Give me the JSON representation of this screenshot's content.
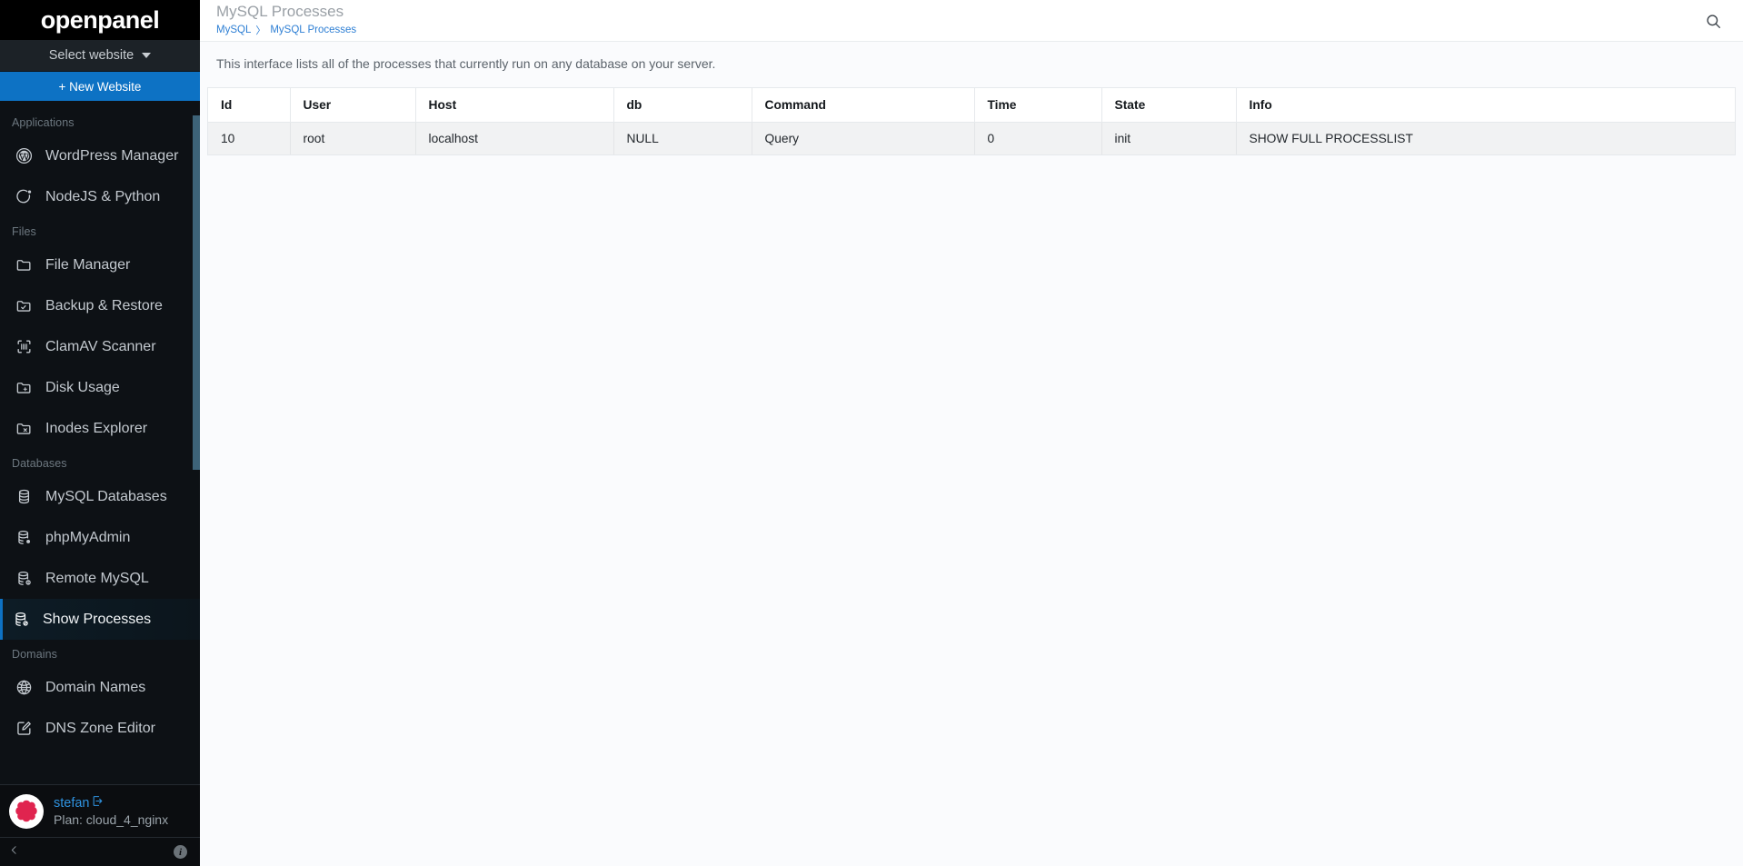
{
  "brand": {
    "name": "openpanel"
  },
  "sidebar": {
    "website_selector": {
      "label": "Select website",
      "icon": "chevron-down-icon"
    },
    "new_website_button": {
      "label": "+ New Website"
    },
    "sections": [
      {
        "label": "Applications",
        "items": [
          {
            "label": "WordPress Manager",
            "icon": "wordpress-icon",
            "active": false
          },
          {
            "label": "NodeJS & Python",
            "icon": "node-python-icon",
            "active": false
          }
        ]
      },
      {
        "label": "Files",
        "items": [
          {
            "label": "File Manager",
            "icon": "folder-icon",
            "active": false
          },
          {
            "label": "Backup & Restore",
            "icon": "folder-check-icon",
            "active": false
          },
          {
            "label": "ClamAV Scanner",
            "icon": "scan-icon",
            "active": false
          },
          {
            "label": "Disk Usage",
            "icon": "folder-plus-icon",
            "active": false
          },
          {
            "label": "Inodes Explorer",
            "icon": "folder-x-icon",
            "active": false
          }
        ]
      },
      {
        "label": "Databases",
        "items": [
          {
            "label": "MySQL Databases",
            "icon": "database-icon",
            "active": false
          },
          {
            "label": "phpMyAdmin",
            "icon": "database-cog-icon",
            "active": false
          },
          {
            "label": "Remote MySQL",
            "icon": "database-info-icon",
            "active": false
          },
          {
            "label": "Show Processes",
            "icon": "database-ban-icon",
            "active": true
          }
        ]
      },
      {
        "label": "Domains",
        "items": [
          {
            "label": "Domain Names",
            "icon": "globe-icon",
            "active": false
          },
          {
            "label": "DNS Zone Editor",
            "icon": "edit-square-icon",
            "active": false
          }
        ]
      }
    ],
    "user": {
      "name": "stefan",
      "logout_icon": "logout-icon",
      "plan": "Plan: cloud_4_nginx",
      "avatar_icon": "avatar-badge-icon"
    },
    "bottom": {
      "collapse_icon": "chevron-left-icon",
      "info_icon": "info-icon",
      "info_label": "i"
    }
  },
  "header": {
    "title": "MySQL Processes",
    "breadcrumb": [
      {
        "label": "MySQL"
      },
      {
        "label": "MySQL Processes"
      }
    ],
    "breadcrumb_separator": "〉",
    "search_icon": "search-icon"
  },
  "main": {
    "intro": "This interface lists all of the processes that currently run on any database on your server.",
    "table": {
      "columns": [
        "Id",
        "User",
        "Host",
        "db",
        "Command",
        "Time",
        "State",
        "Info"
      ],
      "rows": [
        {
          "Id": "10",
          "User": "root",
          "Host": "localhost",
          "db": "NULL",
          "Command": "Query",
          "Time": "0",
          "State": "init",
          "Info": "SHOW FULL PROCESSLIST"
        }
      ]
    }
  },
  "colors": {
    "accent_blue": "#0d72c4",
    "link_blue": "#2e7fd4",
    "sidebar_bg": "#0b0d10",
    "brand_bg": "#000000",
    "avatar_red": "#e0244f",
    "content_bg": "#fafbfd",
    "row_bg": "#f1f2f3"
  }
}
